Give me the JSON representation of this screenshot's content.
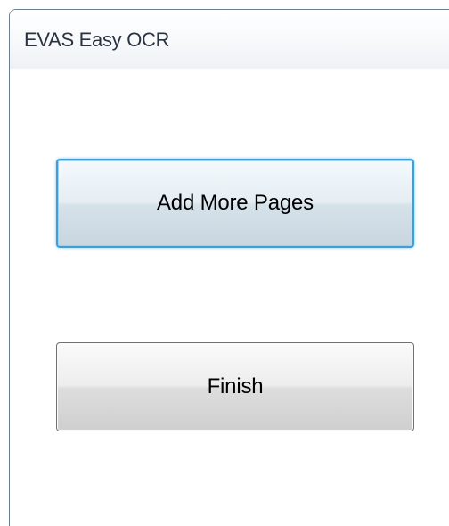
{
  "window": {
    "title": "EVAS Easy OCR"
  },
  "buttons": {
    "add_more_pages_label": "Add More Pages",
    "finish_label": "Finish"
  },
  "colors": {
    "focus_border": "#3c9fd6",
    "button_border": "#707070",
    "title_text": "#2a3440"
  }
}
